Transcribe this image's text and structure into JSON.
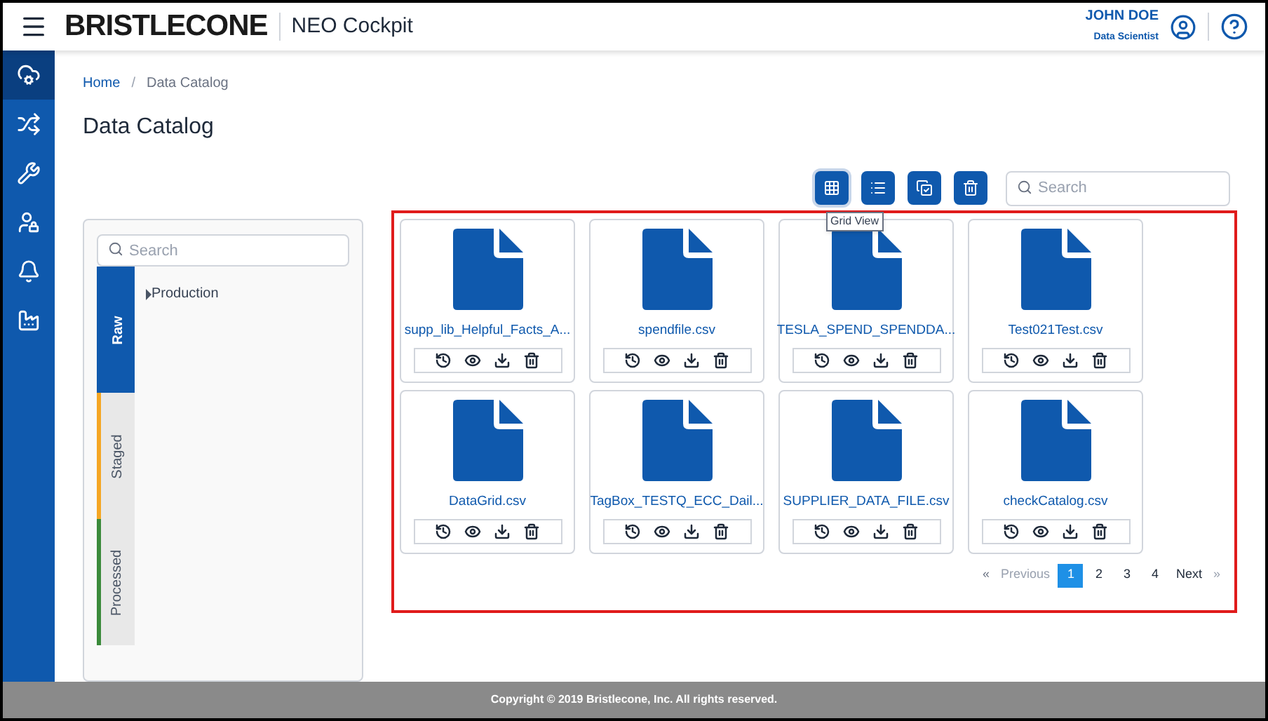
{
  "header": {
    "brand": "BRISTLECONE",
    "product": "NEO Cockpit",
    "user_name": "JOHN DOE",
    "user_role": "Data Scientist"
  },
  "sidebar": {
    "items": [
      {
        "selected": true
      },
      {
        "selected": false
      },
      {
        "selected": false
      },
      {
        "selected": false
      },
      {
        "selected": false
      },
      {
        "selected": false
      }
    ]
  },
  "breadcrumb": [
    "Home",
    "/",
    "Data Catalog"
  ],
  "page_title": "Data Catalog",
  "toolbar": {
    "buttons": [
      {
        "selected": true
      },
      {
        "selected": false
      },
      {
        "selected": false
      },
      {
        "selected": false
      }
    ],
    "search_placeholder": "Search",
    "tooltip": "Grid View"
  },
  "tree_panel": {
    "search_placeholder": "Search",
    "tabs": [
      {
        "label": "Raw",
        "selected": true,
        "color": "#0f59ad"
      },
      {
        "label": "Staged",
        "selected": false,
        "color": "#f5a623"
      },
      {
        "label": "Processed",
        "selected": false,
        "color": "#3a8a3a"
      }
    ],
    "nodes": [
      {
        "label": "Production",
        "expanded": false
      }
    ]
  },
  "files": [
    {
      "name": "supp_lib_Helpful_Facts_A..."
    },
    {
      "name": "spendfile.csv"
    },
    {
      "name": "TESLA_SPEND_SPENDDA..."
    },
    {
      "name": "Test021Test.csv"
    },
    {
      "name": "DataGrid.csv"
    },
    {
      "name": "TagBox_TESTQ_ECC_Dail..."
    },
    {
      "name": "SUPPLIER_DATA_FILE.csv"
    },
    {
      "name": "checkCatalog.csv"
    }
  ],
  "pagination": {
    "previous": "Previous",
    "next": "Next",
    "prev_mark": "«",
    "next_mark": "»",
    "pages": [
      {
        "label": "1",
        "selected": true
      },
      {
        "label": "2",
        "selected": false
      },
      {
        "label": "3",
        "selected": false
      },
      {
        "label": "4",
        "selected": false
      }
    ]
  },
  "footer": "Copyright © 2019 Bristlecone, Inc. All rights reserved."
}
